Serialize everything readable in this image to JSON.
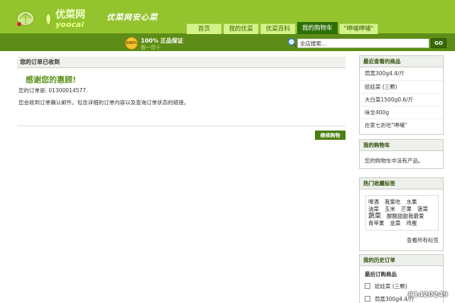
{
  "brand": {
    "name_cn": "优菜网",
    "name_en": "yoocai",
    "slogan": "优菜网安心菜"
  },
  "nav": [
    {
      "label": "首页"
    },
    {
      "label": "我的优菜"
    },
    {
      "label": "优菜百科"
    },
    {
      "label": "我的购物车"
    },
    {
      "label": "\"呷哺呷哺\""
    }
  ],
  "subbar": {
    "badge": "100%",
    "guarantee": "100% 正品保证",
    "guarantee_sub": "假一罚十"
  },
  "search": {
    "value": "全店搜索...",
    "button": "GO"
  },
  "main": {
    "title": "您的订单已收到",
    "thanks": "感谢您的惠顾!",
    "order_number": "您的订单是: 01300014577.",
    "confirm_msg": "您会收到订单确认邮件。包含详细的订单内容以及查询订单状态的链接。",
    "continue_btn": "继续购物"
  },
  "recent": {
    "title": "最近查看的商品",
    "items": [
      "茼蒿300g4.4/斤",
      "娃娃菜 (三颗)",
      "大白菜1500g0.6/斤",
      "味全400g",
      "在家七折吃\"呷哺\""
    ]
  },
  "cart": {
    "title": "我的购物车",
    "empty": "您的购物车中没有产品。"
  },
  "tags": {
    "title": "热门收藏标签",
    "items": [
      "啤酒",
      "我爱吃",
      "水果",
      "油菜",
      "玉米",
      "芒果",
      "菠菜",
      "蔬菜",
      "酸酸甜甜我最爱",
      "青苹果",
      "韭菜",
      "鸡蛋"
    ],
    "view_all": "查看所有标签"
  },
  "history": {
    "title": "我的历史订单",
    "subtitle": "最后订购商品",
    "items": [
      "娃娃菜 (三颗)",
      "茼蒿300g4.4/斤"
    ]
  },
  "watermark": "#1420249",
  "colors": {
    "header": "#93c42d",
    "subbar": "#5d8d18",
    "accent": "#59921a",
    "tab_active": "#2f6f08"
  }
}
